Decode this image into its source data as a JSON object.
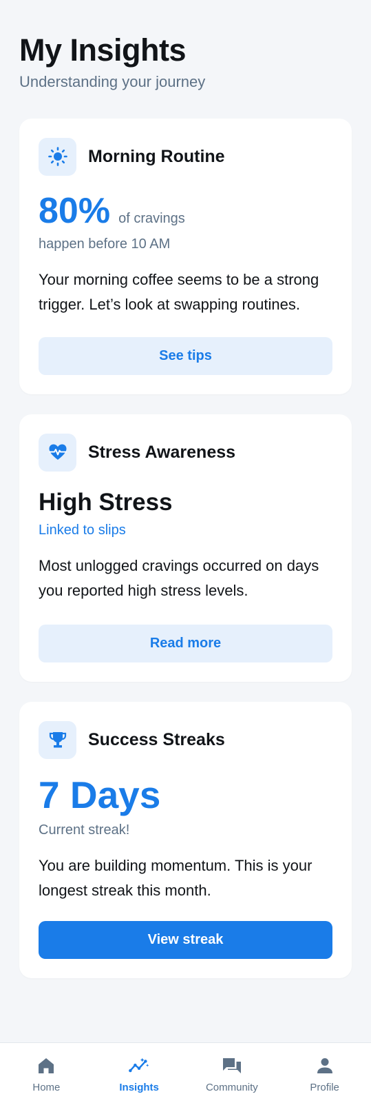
{
  "header": {
    "title": "My Insights",
    "subtitle": "Understanding your journey"
  },
  "colors": {
    "accent": "#1a7ce8",
    "accent_soft": "#e6f0fc",
    "muted_text": "#5d7186",
    "background": "#f4f6f9"
  },
  "cards": [
    {
      "icon": "sun-icon",
      "title": "Morning Routine",
      "metric": "80%",
      "metric_unit": "of cravings",
      "caption": "happen before 10 AM",
      "body": "Your morning coffee seems to be a strong trigger. Let’s look at swapping routines.",
      "button": "See tips"
    },
    {
      "icon": "heart-pulse-icon",
      "title": "Stress Awareness",
      "metric": "High Stress",
      "caption": "Linked to slips",
      "body": "Most unlogged cravings occurred on days you reported high stress levels.",
      "button": "Read more"
    },
    {
      "icon": "trophy-icon",
      "title": "Success Streaks",
      "metric": "7 Days",
      "caption": "Current streak!",
      "body": "You are building momentum. This is your longest streak this month.",
      "button": "View streak"
    }
  ],
  "nav": {
    "items": [
      {
        "label": "Home",
        "icon": "home-icon",
        "active": false
      },
      {
        "label": "Insights",
        "icon": "insights-icon",
        "active": true
      },
      {
        "label": "Community",
        "icon": "chat-icon",
        "active": false
      },
      {
        "label": "Profile",
        "icon": "person-icon",
        "active": false
      }
    ]
  }
}
